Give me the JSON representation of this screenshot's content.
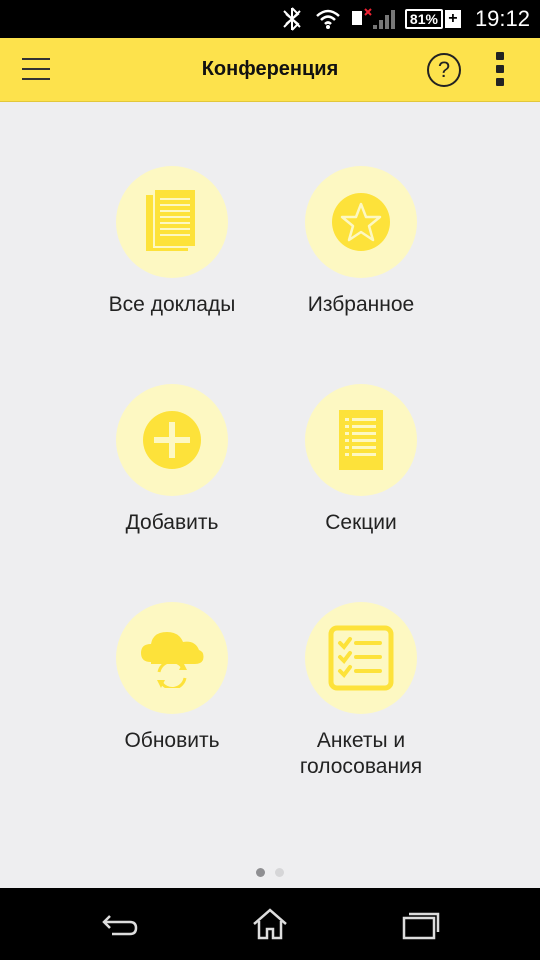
{
  "status_bar": {
    "battery": "81%",
    "time": "19:12"
  },
  "app_bar": {
    "title": "Конференция",
    "help_label": "?"
  },
  "menu": {
    "items": [
      {
        "label": "Все доклады",
        "icon": "document-list-icon"
      },
      {
        "label": "Избранное",
        "icon": "star-icon"
      },
      {
        "label": "Добавить",
        "icon": "plus-circle-icon"
      },
      {
        "label": "Секции",
        "icon": "section-list-icon"
      },
      {
        "label": "Обновить",
        "icon": "cloud-sync-icon"
      },
      {
        "label_line1": "Анкеты и",
        "label_line2": "голосования",
        "icon": "checklist-icon"
      }
    ]
  },
  "pagination": {
    "current": 1,
    "total": 2
  },
  "colors": {
    "accent": "#fde24c",
    "icon_fill": "#fde23a",
    "icon_bg": "#fdf8c2",
    "background": "#eeeef0"
  }
}
